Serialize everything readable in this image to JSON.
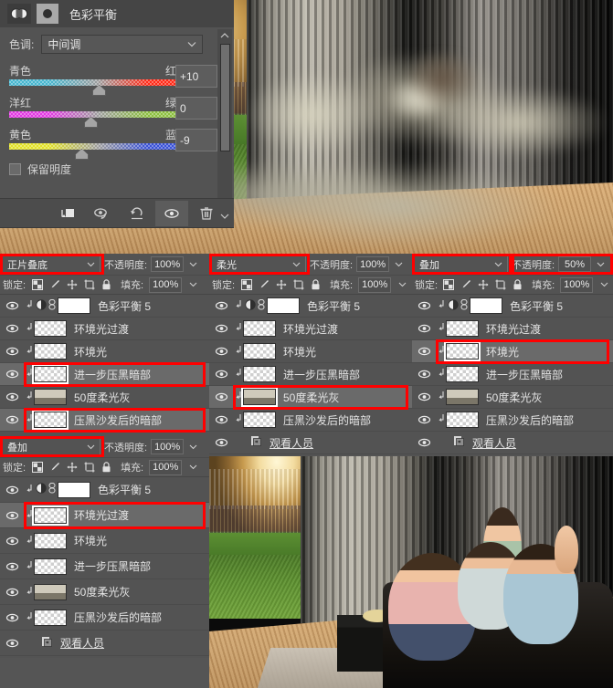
{
  "adjustment_panel": {
    "title": "色彩平衡",
    "icon": "color-balance-icon",
    "mask_icon": "layer-mask-thumbnail",
    "tone_label": "色调:",
    "tone_value": "中间调",
    "sliders": [
      {
        "name": "cyan-red",
        "left_label": "青色",
        "right_label": "红色",
        "value": "+10",
        "knob_pct": 52
      },
      {
        "name": "magenta-green",
        "left_label": "洋红",
        "right_label": "绿色",
        "value": "0",
        "knob_pct": 47
      },
      {
        "name": "yellow-blue",
        "left_label": "黄色",
        "right_label": "蓝色",
        "value": "-9",
        "knob_pct": 40
      }
    ],
    "preserve_luminosity_label": "保留明度",
    "preserve_luminosity_checked": false,
    "footer_buttons": [
      {
        "name": "clip-to-layer-button",
        "icon": "clip-to-layer-icon"
      },
      {
        "name": "view-previous-state-button",
        "icon": "eye-arrow-icon"
      },
      {
        "name": "reset-button",
        "icon": "reset-arrow-icon"
      },
      {
        "name": "toggle-visibility-button",
        "icon": "eye-icon",
        "selected": true
      },
      {
        "name": "delete-adjustment-button",
        "icon": "trash-icon"
      }
    ]
  },
  "common": {
    "opacity_label": "不透明度:",
    "fill_label": "填充:",
    "lock_label": "锁定:",
    "lock_icons": [
      "transparency-lock-icon",
      "brush-lock-icon",
      "move-lock-icon",
      "artboard-lock-icon",
      "lock-all-icon"
    ],
    "highlight_color": "#ff0000"
  },
  "panels": [
    {
      "id": "panel-top-left",
      "blend_mode": "正片叠底",
      "opacity": "100%",
      "fill": "100%",
      "blend_highlighted": true,
      "opacity_highlighted": false,
      "layers": [
        {
          "name": "色彩平衡 5",
          "type": "adjustment",
          "clipped": true,
          "visible": true,
          "selected": false,
          "highlighted": false
        },
        {
          "name": "环境光过渡",
          "type": "pixel",
          "clipped": true,
          "visible": true,
          "selected": false,
          "highlighted": false
        },
        {
          "name": "环境光",
          "type": "pixel",
          "clipped": true,
          "visible": true,
          "selected": false,
          "highlighted": false
        },
        {
          "name": "进一步压黑暗部",
          "type": "pixel",
          "clipped": true,
          "visible": true,
          "selected": true,
          "highlighted": true
        },
        {
          "name": "50度柔光灰",
          "type": "photo",
          "clipped": true,
          "visible": true,
          "selected": false,
          "highlighted": false
        },
        {
          "name": "压黑沙发后的暗部",
          "type": "pixel",
          "clipped": true,
          "visible": true,
          "selected": true,
          "highlighted": true
        },
        {
          "name": "观看人员",
          "type": "smart-object",
          "clipped": false,
          "visible": true,
          "selected": false,
          "highlighted": false
        }
      ]
    },
    {
      "id": "panel-top-mid",
      "blend_mode": "柔光",
      "opacity": "100%",
      "fill": "100%",
      "blend_highlighted": true,
      "opacity_highlighted": false,
      "layers": [
        {
          "name": "色彩平衡 5",
          "type": "adjustment",
          "clipped": true,
          "visible": true,
          "selected": false,
          "highlighted": false
        },
        {
          "name": "环境光过渡",
          "type": "pixel",
          "clipped": true,
          "visible": true,
          "selected": false,
          "highlighted": false
        },
        {
          "name": "环境光",
          "type": "pixel",
          "clipped": true,
          "visible": true,
          "selected": false,
          "highlighted": false
        },
        {
          "name": "进一步压黑暗部",
          "type": "pixel",
          "clipped": true,
          "visible": true,
          "selected": false,
          "highlighted": false
        },
        {
          "name": "50度柔光灰",
          "type": "photo",
          "clipped": true,
          "visible": true,
          "selected": true,
          "highlighted": true
        },
        {
          "name": "压黑沙发后的暗部",
          "type": "pixel",
          "clipped": true,
          "visible": true,
          "selected": false,
          "highlighted": false
        },
        {
          "name": "观看人员",
          "type": "smart-object",
          "clipped": false,
          "visible": true,
          "selected": false,
          "highlighted": false
        }
      ]
    },
    {
      "id": "panel-top-right",
      "blend_mode": "叠加",
      "opacity": "50%",
      "fill": "100%",
      "blend_highlighted": true,
      "opacity_highlighted": true,
      "layers": [
        {
          "name": "色彩平衡 5",
          "type": "adjustment",
          "clipped": true,
          "visible": true,
          "selected": false,
          "highlighted": false
        },
        {
          "name": "环境光过渡",
          "type": "pixel",
          "clipped": true,
          "visible": true,
          "selected": false,
          "highlighted": false
        },
        {
          "name": "环境光",
          "type": "pixel",
          "clipped": true,
          "visible": true,
          "selected": true,
          "highlighted": true
        },
        {
          "name": "进一步压黑暗部",
          "type": "pixel",
          "clipped": true,
          "visible": true,
          "selected": false,
          "highlighted": false
        },
        {
          "name": "50度柔光灰",
          "type": "photo",
          "clipped": true,
          "visible": true,
          "selected": false,
          "highlighted": false
        },
        {
          "name": "压黑沙发后的暗部",
          "type": "pixel",
          "clipped": true,
          "visible": true,
          "selected": false,
          "highlighted": false
        },
        {
          "name": "观看人员",
          "type": "smart-object",
          "clipped": false,
          "visible": true,
          "selected": false,
          "highlighted": false
        }
      ]
    },
    {
      "id": "panel-bottom-left",
      "blend_mode": "叠加",
      "opacity": "100%",
      "fill": "100%",
      "blend_highlighted": true,
      "opacity_highlighted": false,
      "layers": [
        {
          "name": "色彩平衡 5",
          "type": "adjustment",
          "clipped": true,
          "visible": true,
          "selected": false,
          "highlighted": false
        },
        {
          "name": "环境光过渡",
          "type": "pixel",
          "clipped": true,
          "visible": true,
          "selected": true,
          "highlighted": true
        },
        {
          "name": "环境光",
          "type": "pixel",
          "clipped": true,
          "visible": true,
          "selected": false,
          "highlighted": false
        },
        {
          "name": "进一步压黑暗部",
          "type": "pixel",
          "clipped": true,
          "visible": true,
          "selected": false,
          "highlighted": false
        },
        {
          "name": "50度柔光灰",
          "type": "photo",
          "clipped": true,
          "visible": true,
          "selected": false,
          "highlighted": false
        },
        {
          "name": "压黑沙发后的暗部",
          "type": "pixel",
          "clipped": true,
          "visible": true,
          "selected": false,
          "highlighted": false
        },
        {
          "name": "观看人员",
          "type": "smart-object",
          "clipped": false,
          "visible": true,
          "selected": false,
          "highlighted": false
        }
      ]
    }
  ],
  "scenes": {
    "top": {
      "name": "living-room-stadium-smudged-preview"
    },
    "bottom": {
      "name": "living-room-stadium-final-preview"
    }
  }
}
